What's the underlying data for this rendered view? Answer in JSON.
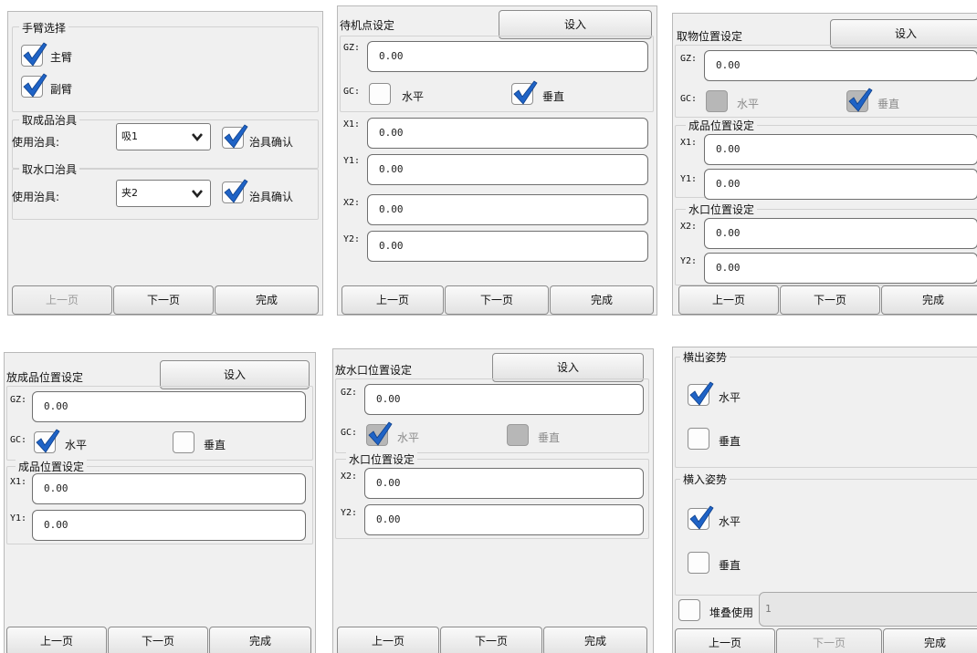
{
  "nav": {
    "prev": "上一页",
    "next": "下一页",
    "done": "完成",
    "set_in": "设入"
  },
  "p1": {
    "arm_title": "手臂选择",
    "main_arm": "主臂",
    "sub_arm": "副臂",
    "product_title": "取成品治具",
    "use_fixture": "使用治具:",
    "product_fixture": "吸1",
    "fixture_confirm": "治具确认",
    "sprue_title": "取水口治具",
    "sprue_fixture": "夹2"
  },
  "p2": {
    "title": "待机点设定",
    "gz_label": "GZ:",
    "gz": "0.00",
    "gc_label": "GC:",
    "horizontal": "水平",
    "vertical": "垂直",
    "x1_label": "X1:",
    "x1": "0.00",
    "y1_label": "Y1:",
    "y1": "0.00",
    "x2_label": "X2:",
    "x2": "0.00",
    "y2_label": "Y2:",
    "y2": "0.00"
  },
  "p3": {
    "title": "取物位置设定",
    "gz_label": "GZ:",
    "gz": "0.00",
    "gc_label": "GC:",
    "horizontal": "水平",
    "vertical": "垂直",
    "product_title": "成品位置设定",
    "x1_label": "X1:",
    "x1": "0.00",
    "y1_label": "Y1:",
    "y1": "0.00",
    "sprue_title": "水口位置设定",
    "x2_label": "X2:",
    "x2": "0.00",
    "y2_label": "Y2:",
    "y2": "0.00"
  },
  "p4": {
    "title": "放成品位置设定",
    "gz_label": "GZ:",
    "gz": "0.00",
    "gc_label": "GC:",
    "horizontal": "水平",
    "vertical": "垂直",
    "product_title": "成品位置设定",
    "x1_label": "X1:",
    "x1": "0.00",
    "y1_label": "Y1:",
    "y1": "0.00"
  },
  "p5": {
    "title": "放水口位置设定",
    "gz_label": "GZ:",
    "gz": "0.00",
    "gc_label": "GC:",
    "horizontal": "水平",
    "vertical": "垂直",
    "sprue_title": "水口位置设定",
    "x2_label": "X2:",
    "x2": "0.00",
    "y2_label": "Y2:",
    "y2": "0.00"
  },
  "p6": {
    "out_title": "横出姿势",
    "in_title": "横入姿势",
    "horizontal": "水平",
    "vertical": "垂直",
    "stack_label": "堆叠使用",
    "stack_value": "1"
  },
  "colors": {
    "check": "#1f63c6",
    "panel_bg": "#f0f0f0",
    "border": "#6f6f6f"
  },
  "icons": {
    "checkmark": "checkmark-icon",
    "dropdown": "chevron-down-icon"
  }
}
